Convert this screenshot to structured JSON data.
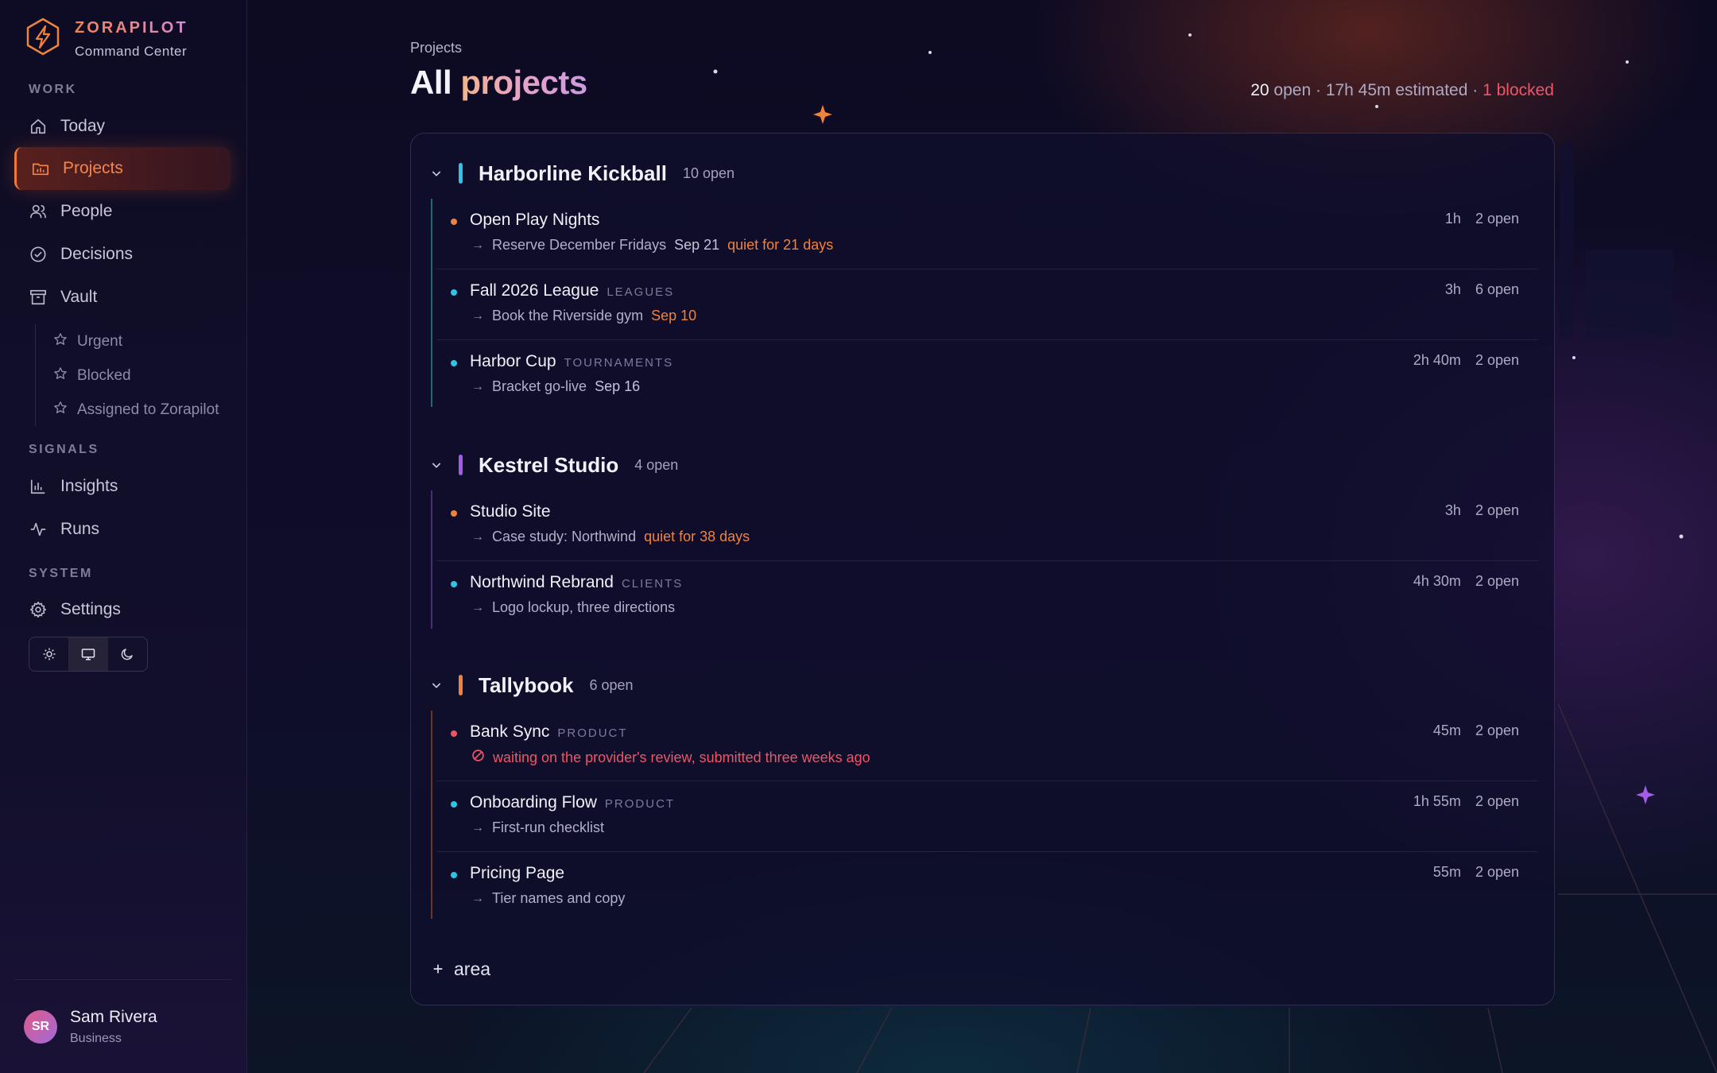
{
  "brand": {
    "name": "ZORAPILOT",
    "subtitle": "Command Center"
  },
  "sidebar": {
    "sections": {
      "work": "WORK",
      "signals": "SIGNALS",
      "system": "SYSTEM"
    },
    "items": {
      "today": "Today",
      "projects": "Projects",
      "people": "People",
      "decisions": "Decisions",
      "vault": "Vault",
      "insights": "Insights",
      "runs": "Runs",
      "settings": "Settings"
    },
    "vault_items": [
      "Urgent",
      "Blocked",
      "Assigned to Zorapilot"
    ],
    "active": "projects",
    "theme_options": [
      "light",
      "system",
      "dark"
    ],
    "theme_selected": "system"
  },
  "user": {
    "initials": "SR",
    "name": "Sam Rivera",
    "plan": "Business"
  },
  "page": {
    "breadcrumb": "Projects",
    "title_a": "All",
    "title_b": "projects",
    "summary": {
      "open_count": "20",
      "open_label": "open",
      "estimated": "17h 45m estimated",
      "blocked": "1 blocked"
    }
  },
  "areas": [
    {
      "name": "Harborline Kickball",
      "count": "10 open",
      "color": "#2fc4e6",
      "projects": [
        {
          "name": "Open Play Nights",
          "tag": "",
          "dot": "#f0823c",
          "next": "Reserve December Fridays",
          "date": "Sep 21",
          "warn": "quiet for 21 days",
          "time": "1h",
          "open": "2 open"
        },
        {
          "name": "Fall 2026 League",
          "tag": "LEAGUES",
          "dot": "#2fc4e6",
          "next": "Book the Riverside gym",
          "date": "",
          "warn": "Sep 10",
          "time": "3h",
          "open": "6 open"
        },
        {
          "name": "Harbor Cup",
          "tag": "TOURNAMENTS",
          "dot": "#2fc4e6",
          "next": "Bracket go-live",
          "date": "Sep 16",
          "warn": "",
          "time": "2h 40m",
          "open": "2 open"
        }
      ]
    },
    {
      "name": "Kestrel Studio",
      "count": "4 open",
      "color": "#a45be8",
      "projects": [
        {
          "name": "Studio Site",
          "tag": "",
          "dot": "#f0823c",
          "next": "Case study: Northwind",
          "date": "",
          "warn": "quiet for 38 days",
          "time": "3h",
          "open": "2 open"
        },
        {
          "name": "Northwind Rebrand",
          "tag": "CLIENTS",
          "dot": "#2fc4e6",
          "next": "Logo lockup, three directions",
          "date": "",
          "warn": "",
          "time": "4h 30m",
          "open": "2 open"
        }
      ]
    },
    {
      "name": "Tallybook",
      "count": "6 open",
      "color": "#f0823c",
      "projects": [
        {
          "name": "Bank Sync",
          "tag": "PRODUCT",
          "dot": "#ee5668",
          "blocked": "waiting on the provider's review, submitted three weeks ago",
          "time": "45m",
          "open": "2 open"
        },
        {
          "name": "Onboarding Flow",
          "tag": "PRODUCT",
          "dot": "#2fc4e6",
          "next": "First-run checklist",
          "date": "",
          "warn": "",
          "time": "1h 55m",
          "open": "2 open"
        },
        {
          "name": "Pricing Page",
          "tag": "",
          "dot": "#2fc4e6",
          "next": "Tier names and copy",
          "date": "",
          "warn": "",
          "time": "55m",
          "open": "2 open"
        }
      ]
    }
  ],
  "add_area_label": "area"
}
